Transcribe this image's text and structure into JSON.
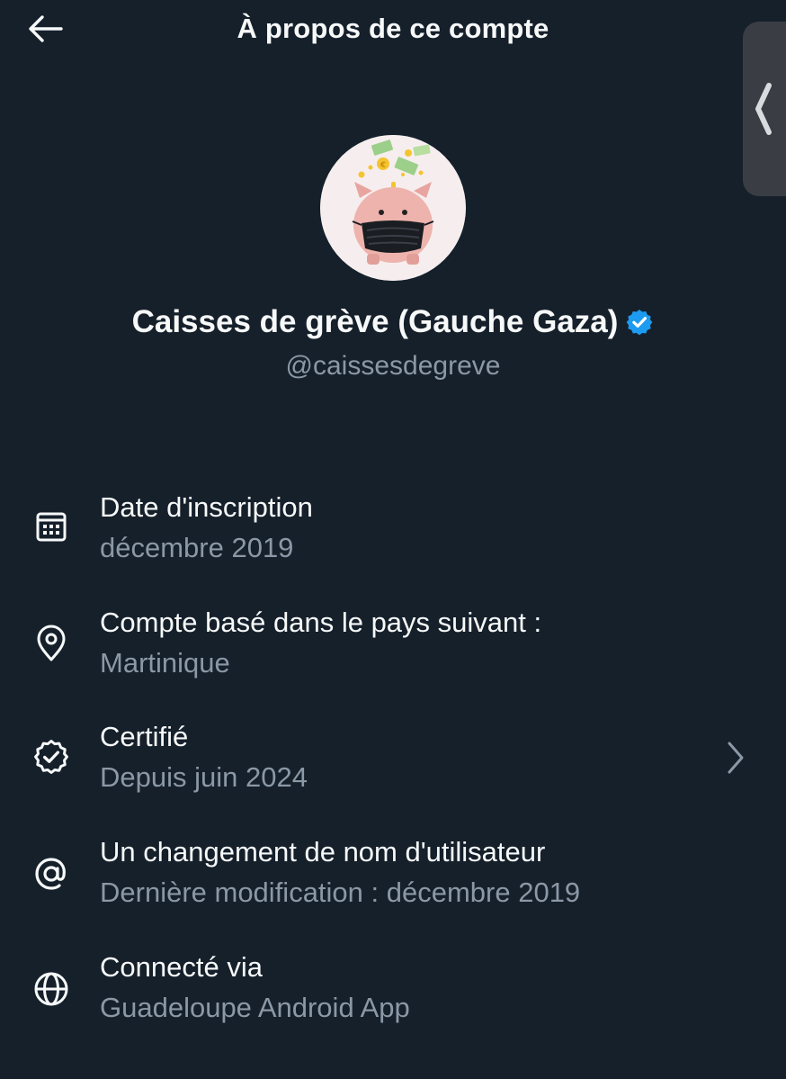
{
  "header": {
    "title": "À propos de ce compte",
    "back_icon": "arrow-left-icon"
  },
  "side_handle": {
    "icon": "chevron-left-icon"
  },
  "profile": {
    "avatar_description_icon": "piggy-bank-mask-avatar",
    "display_name": "Caisses de grève (Gauche Gaza)",
    "verified_icon": "verified-badge-icon",
    "handle": "@caissesdegreve"
  },
  "info": [
    {
      "icon": "calendar-icon",
      "title": "Date d'inscription",
      "value": "décembre 2019"
    },
    {
      "icon": "location-pin-icon",
      "title": "Compte basé dans le pays suivant :",
      "value": "Martinique"
    },
    {
      "icon": "verified-outline-icon",
      "title": "Certifié",
      "value": "Depuis juin 2024",
      "has_chevron": true
    },
    {
      "icon": "at-sign-icon",
      "title": "Un changement de nom d'utilisateur",
      "value": "Dernière modification : décembre 2019"
    },
    {
      "icon": "globe-icon",
      "title": "Connecté via",
      "value": "Guadeloupe Android App"
    }
  ],
  "colors": {
    "background": "#15202b",
    "primary_text": "#f7f9f9",
    "secondary_text": "#8b98a5",
    "verified_blue": "#1d9bf0"
  }
}
